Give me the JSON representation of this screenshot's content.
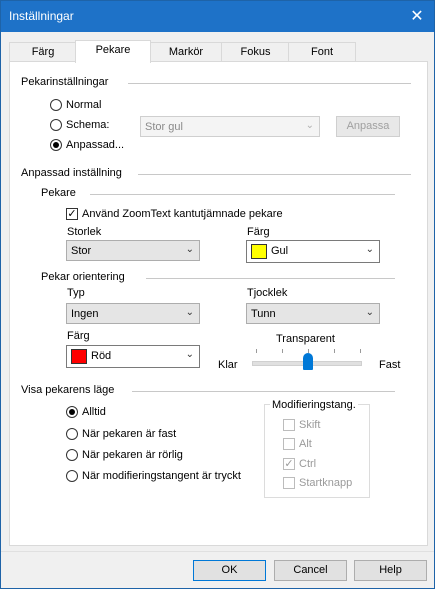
{
  "window": {
    "title": "Inställningar",
    "close_glyph": "✕"
  },
  "tabs": [
    {
      "label": "Färg",
      "active": false
    },
    {
      "label": "Pekare",
      "active": true
    },
    {
      "label": "Markör",
      "active": false
    },
    {
      "label": "Fokus",
      "active": false
    },
    {
      "label": "Font",
      "active": false
    }
  ],
  "pointer_settings": {
    "heading": "Pekarinställningar",
    "normal_label": "Normal",
    "scheme_label": "Schema:",
    "scheme_value": "Stor gul",
    "adjust_button": "Anpassa",
    "custom_label": "Anpassad..."
  },
  "custom": {
    "heading": "Anpassad inställning",
    "pointer_heading": "Pekare",
    "smooth_label": "Använd ZoomText kantutjämnade pekare",
    "smooth_checked": true,
    "size_label": "Storlek",
    "size_value": "Stor",
    "color_label": "Färg",
    "color_value": "Gul",
    "color_hex": "#ffff00"
  },
  "orientation": {
    "heading": "Pekar orientering",
    "type_label": "Typ",
    "type_value": "Ingen",
    "thickness_label": "Tjocklek",
    "thickness_value": "Tunn",
    "color_label": "Färg",
    "color_value": "Röd",
    "color_hex": "#ff0000",
    "transparent_label": "Transparent",
    "clear_label": "Klar",
    "solid_label": "Fast",
    "transparency_level": 0.5
  },
  "show_position": {
    "heading": "Visa pekarens läge",
    "options": [
      "Alltid",
      "När pekaren är fast",
      "När pekaren är rörlig",
      "När modifieringstangent är tryckt"
    ],
    "selected": 0
  },
  "modifiers": {
    "heading": "Modifieringstang.",
    "items": [
      {
        "label": "Skift",
        "checked": false
      },
      {
        "label": "Alt",
        "checked": false
      },
      {
        "label": "Ctrl",
        "checked": true
      },
      {
        "label": "Startknapp",
        "checked": false
      }
    ]
  },
  "buttons": {
    "ok": "OK",
    "cancel": "Cancel",
    "help": "Help"
  },
  "icons": {
    "arrow": "chevron-down-icon",
    "check": "checkmark-icon"
  }
}
